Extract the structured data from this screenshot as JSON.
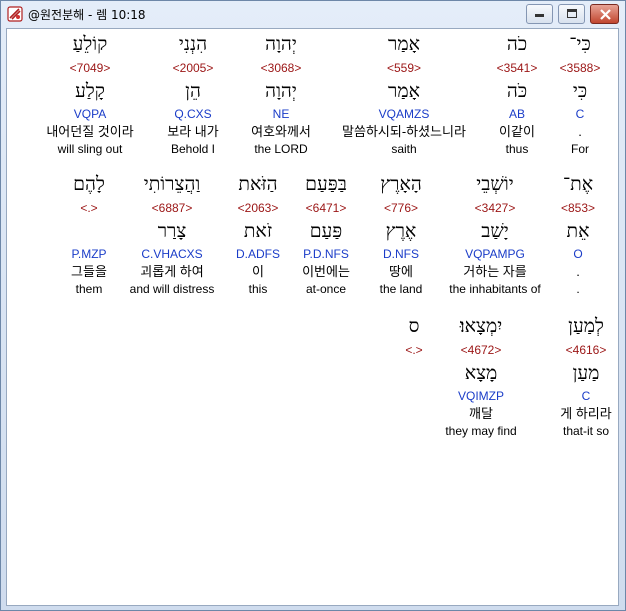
{
  "window": {
    "title": "@원전분해 - 렘 10:18"
  },
  "rows": [
    [
      {
        "hebrew": "כִּי־",
        "strong": "<3588>",
        "lemma": "כִּי",
        "morph": "C",
        "korean": ".",
        "english": "For"
      },
      {
        "hebrew": "כֹה",
        "strong": "<3541>",
        "lemma": "כֹּה",
        "morph": "AB",
        "korean": "이같이",
        "english": "thus"
      },
      {
        "hebrew": "אָמַר",
        "strong": "<559>",
        "lemma": "אָמַר",
        "morph": "VQAMZS",
        "korean": "말씀하시되-하셨느니라",
        "english": "saith"
      },
      {
        "hebrew": "יְהוָה",
        "strong": "<3068>",
        "lemma": "יְהוָה",
        "morph": "NE",
        "korean": "여호와께서",
        "english": "the LORD"
      },
      {
        "hebrew": "הִנְנִי",
        "strong": "<2005>",
        "lemma": "הֵן",
        "morph": "Q.CXS",
        "korean": "보라 내가",
        "english": "Behold I"
      },
      {
        "hebrew": "קוֹלֵעַ",
        "strong": "<7049>",
        "lemma": "קָלַע",
        "morph": "VQPA",
        "korean": "내어던질 것이라",
        "english": "will sling out"
      }
    ],
    [
      {
        "hebrew": "אֶת־",
        "strong": "<853>",
        "lemma": "אֵת",
        "morph": "O",
        "korean": ".",
        "english": "."
      },
      {
        "hebrew": "יוֹשְׁבֵי",
        "strong": "<3427>",
        "lemma": "יָשַׁב",
        "morph": "VQPAMPG",
        "korean": "거하는 자를",
        "english": "the inhabitants of"
      },
      {
        "hebrew": "הָאָרֶץ",
        "strong": "<776>",
        "lemma": "אֶרֶץ",
        "morph": "D.NFS",
        "korean": "땅에",
        "english": "the land"
      },
      {
        "hebrew": "בַּפַּעַם",
        "strong": "<6471>",
        "lemma": "פַּעַם",
        "morph": "P.D.NFS",
        "korean": "이번에는",
        "english": "at-once"
      },
      {
        "hebrew": "הַזֹּאת",
        "strong": "<2063>",
        "lemma": "זֹאת",
        "morph": "D.ADFS",
        "korean": "이",
        "english": "this"
      },
      {
        "hebrew": "וַהֲצֵרוֹתִי",
        "strong": "<6887>",
        "lemma": "צָרַר",
        "morph": "C.VHACXS",
        "korean": "괴롭게 하여",
        "english": "and will distress"
      },
      {
        "hebrew": "לָהֶם",
        "strong": "<.>",
        "lemma": "",
        "morph": "P.MZP",
        "korean": "그들을",
        "english": "them"
      }
    ],
    [
      {
        "hebrew": "לְמַעַן",
        "strong": "<4616>",
        "lemma": "מַעַן",
        "morph": "C",
        "korean": "게 하리라",
        "english": "that-it so"
      },
      {
        "hebrew": "יִמְצָאוּ׃",
        "strong": "<4672>",
        "lemma": "מָצָא",
        "morph": "VQIMZP",
        "korean": "깨달",
        "english": "they may find"
      },
      {
        "hebrew": "ס",
        "strong": "<.>",
        "lemma": "",
        "morph": "",
        "korean": "",
        "english": ""
      }
    ]
  ]
}
